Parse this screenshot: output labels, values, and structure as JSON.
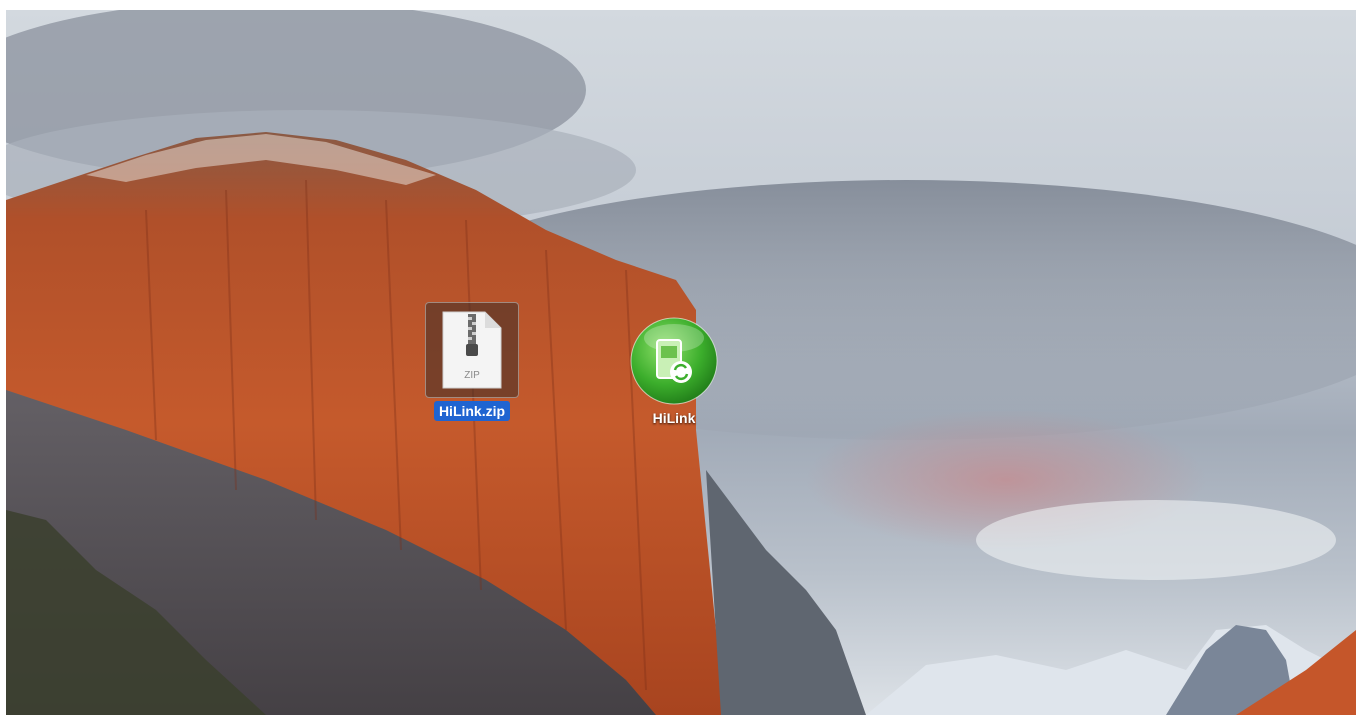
{
  "desktop": {
    "wallpaper": "mountain-cliff-wallpaper",
    "icons": [
      {
        "label": "HiLink.zip",
        "icon": "zip-archive-icon",
        "badge_text": "ZIP",
        "selected": true,
        "selection_color": "#1f64d1"
      },
      {
        "label": "HiLink",
        "icon": "hilink-app-icon",
        "selected": false,
        "accent_color": "#3cae2c"
      }
    ]
  }
}
